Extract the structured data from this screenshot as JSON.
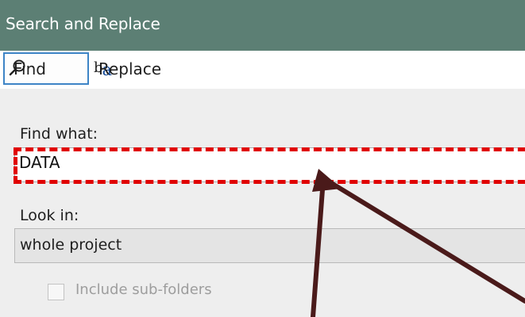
{
  "window": {
    "title": "Search and Replace"
  },
  "toolbar": {
    "find_tab": {
      "label": "Find",
      "icon": "magnifier-icon",
      "selected": true
    },
    "replace_tab": {
      "label": "Replace",
      "icon": "replace-ba-icon",
      "icon_text_b": "b",
      "icon_text_a": "a"
    }
  },
  "form": {
    "find_what_label": "Find what:",
    "find_what_value": "DATA",
    "look_in_label": "Look in:",
    "look_in_value": "whole project",
    "include_subfolders_label": "Include sub-folders",
    "include_subfolders_checked": false,
    "include_subfolders_enabled": false
  },
  "annotations": {
    "highlight_color": "#e00000",
    "arrow_color": "#4a1a1a"
  },
  "colors": {
    "titlebar": "#5c7f74",
    "selected_border": "#3d84c6",
    "panel": "#eeeeee"
  }
}
